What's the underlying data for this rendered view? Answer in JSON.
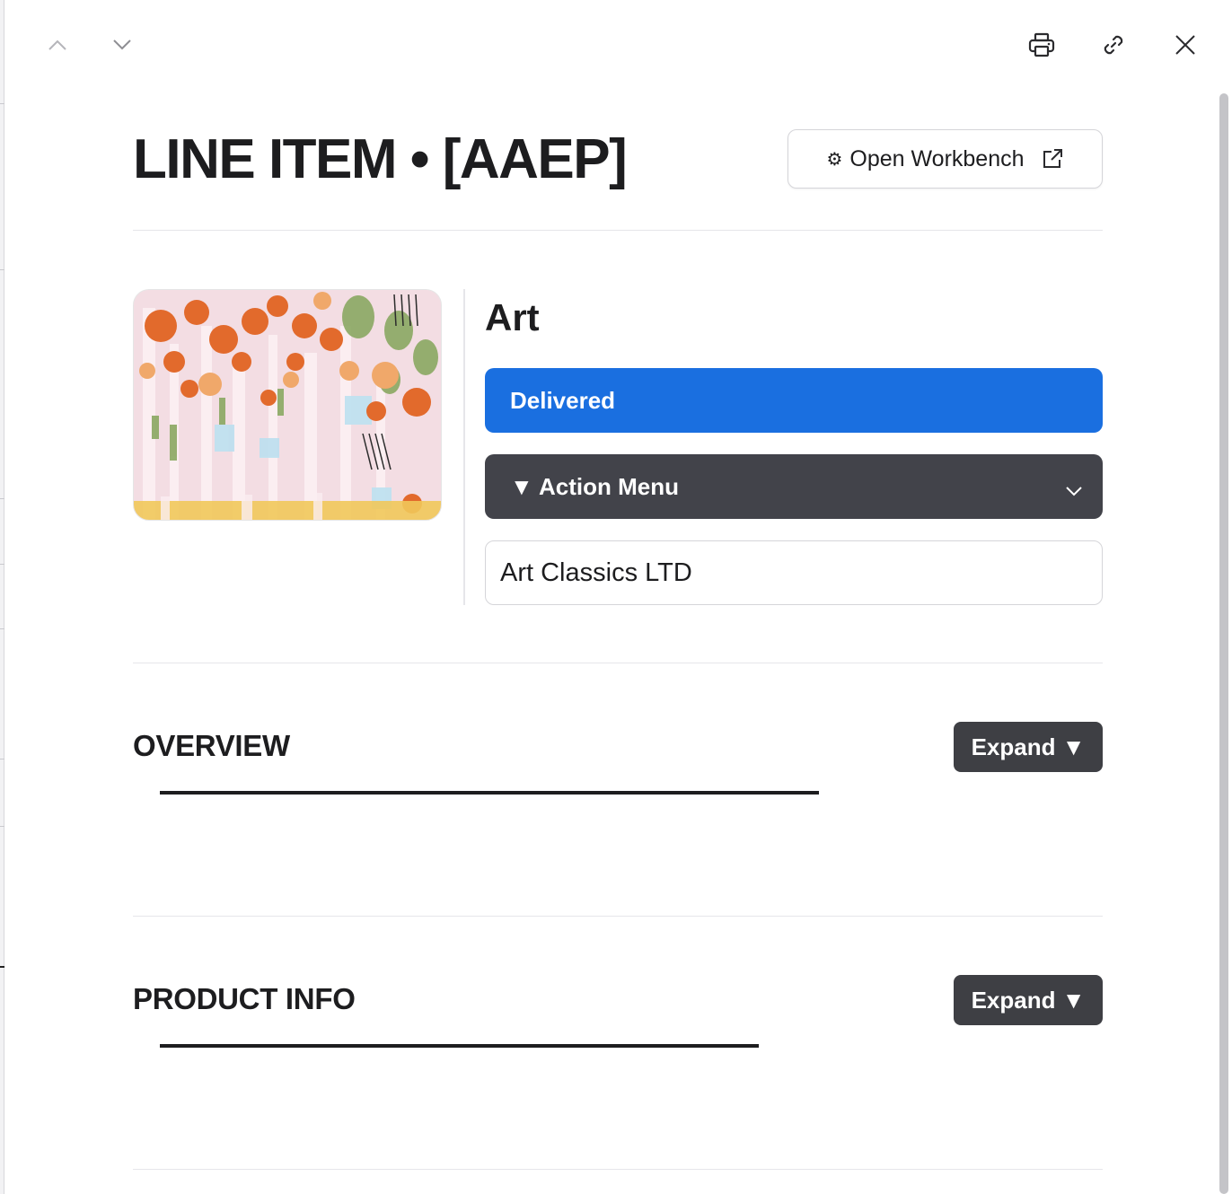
{
  "toolbar": {
    "prev_icon": "chevron-up-icon",
    "next_icon": "chevron-down-icon",
    "print_icon": "printer-icon",
    "link_icon": "link-icon",
    "close_icon": "close-icon"
  },
  "header": {
    "title": "LINE ITEM • [AAEP]",
    "workbench_gear": "⚙",
    "workbench_label": "Open Workbench",
    "workbench_icon": "external-link-icon"
  },
  "item": {
    "image_alt": "abstract floral painting",
    "name": "Art",
    "status": "Delivered",
    "action_menu": "▼ Action Menu",
    "vendor": "Art Classics LTD"
  },
  "sections": [
    {
      "title": "OVERVIEW",
      "button": "Expand ▼"
    },
    {
      "title": "PRODUCT INFO",
      "button": "Expand ▼"
    }
  ],
  "colors": {
    "status_blue": "#1a6fe0",
    "action_dark": "#42434a",
    "expand_dark": "#3e3f44"
  }
}
